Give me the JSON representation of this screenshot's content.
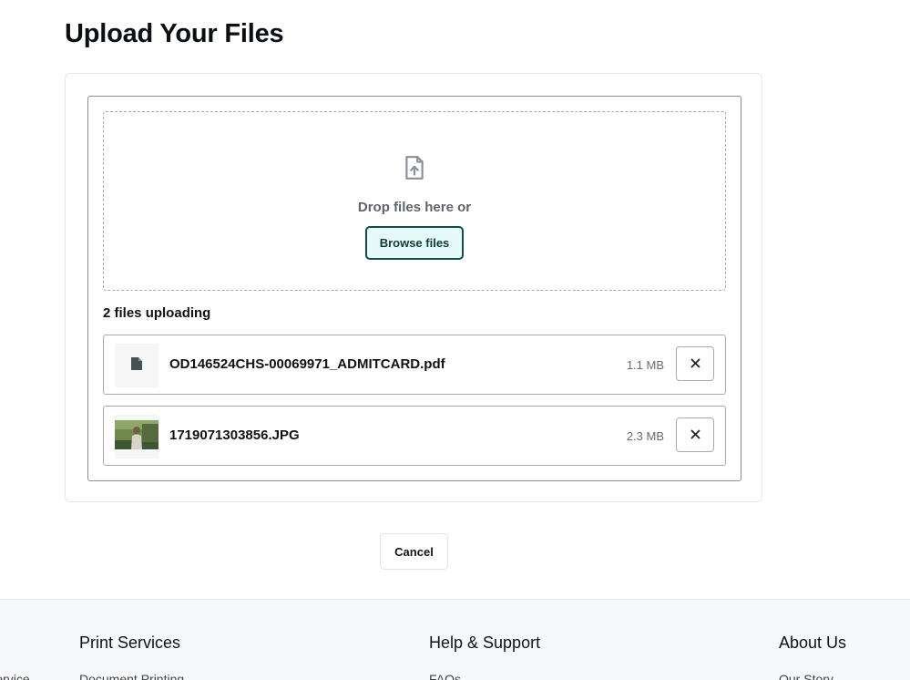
{
  "page": {
    "title": "Upload Your Files"
  },
  "uploader": {
    "drop_text": "Drop files here or",
    "browse_label": "Browse files",
    "status": "2 files uploading",
    "files": [
      {
        "name": "OD146524CHS-00069971_ADMITCARD.pdf",
        "size": "1.1 MB",
        "thumb": "document-icon"
      },
      {
        "name": "1719071303856.JPG",
        "size": "2.3 MB",
        "thumb": "photo-thumbnail"
      }
    ],
    "remove_icon": "close-icon"
  },
  "actions": {
    "cancel_label": "Cancel"
  },
  "footer": {
    "columns": [
      {
        "heading": "Print Services",
        "first_link": "Document Printing"
      },
      {
        "heading": "Help & Support",
        "first_link": "FAQs"
      },
      {
        "heading": "About Us",
        "first_link": "Our Story"
      }
    ],
    "left_cut_link": "Service"
  },
  "colors": {
    "browse_border": "#114b4a",
    "browse_bg": "#e6fafa",
    "footer_bg": "#f7f8fa"
  }
}
